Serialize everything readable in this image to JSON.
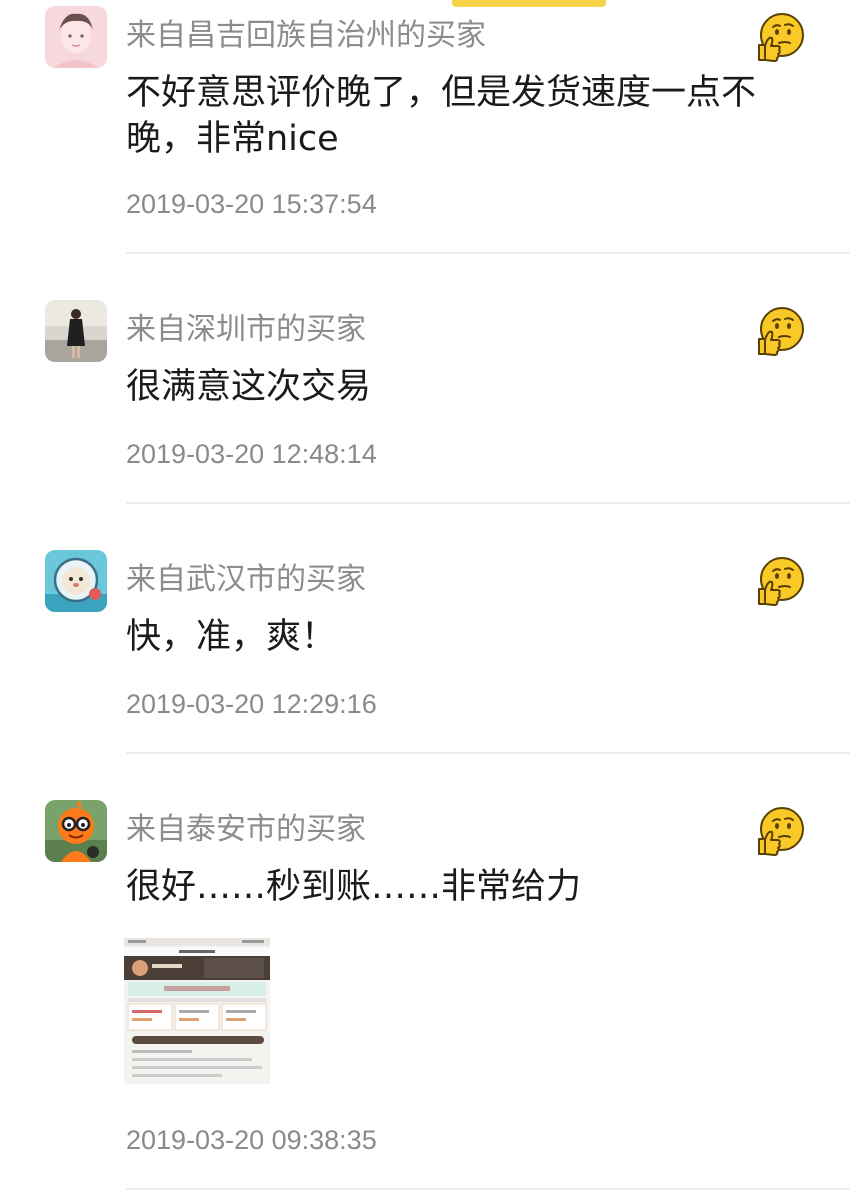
{
  "reviews": [
    {
      "buyer": "来自昌吉回族自治州的买家",
      "comment": "不好意思评价晚了，但是发货速度一点不晚，非常nice",
      "time": "2019-03-20 15:37:54",
      "avatar": "portrait-avatar-pink"
    },
    {
      "buyer": "来自深圳市的买家",
      "comment": "很满意这次交易",
      "time": "2019-03-20 12:48:14",
      "avatar": "girl-standing-avatar"
    },
    {
      "buyer": "来自武汉市的买家",
      "comment": "快，准，爽！",
      "time": "2019-03-20 12:29:16",
      "avatar": "astronaut-cat-avatar"
    },
    {
      "buyer": "来自泰安市的买家",
      "comment": "很好……秒到账……非常给力",
      "time": "2019-03-20 09:38:35",
      "avatar": "orange-cartoon-glasses-avatar",
      "has_photo": true
    }
  ],
  "reaction_icon": "thinking-face-thumbs-up-emoji",
  "colors": {
    "accent": "#f7d348",
    "buyer_text": "#8c8c8c",
    "comment_text": "#1b1b1b",
    "time_text": "#8a8a8a",
    "divider": "#efefef"
  }
}
